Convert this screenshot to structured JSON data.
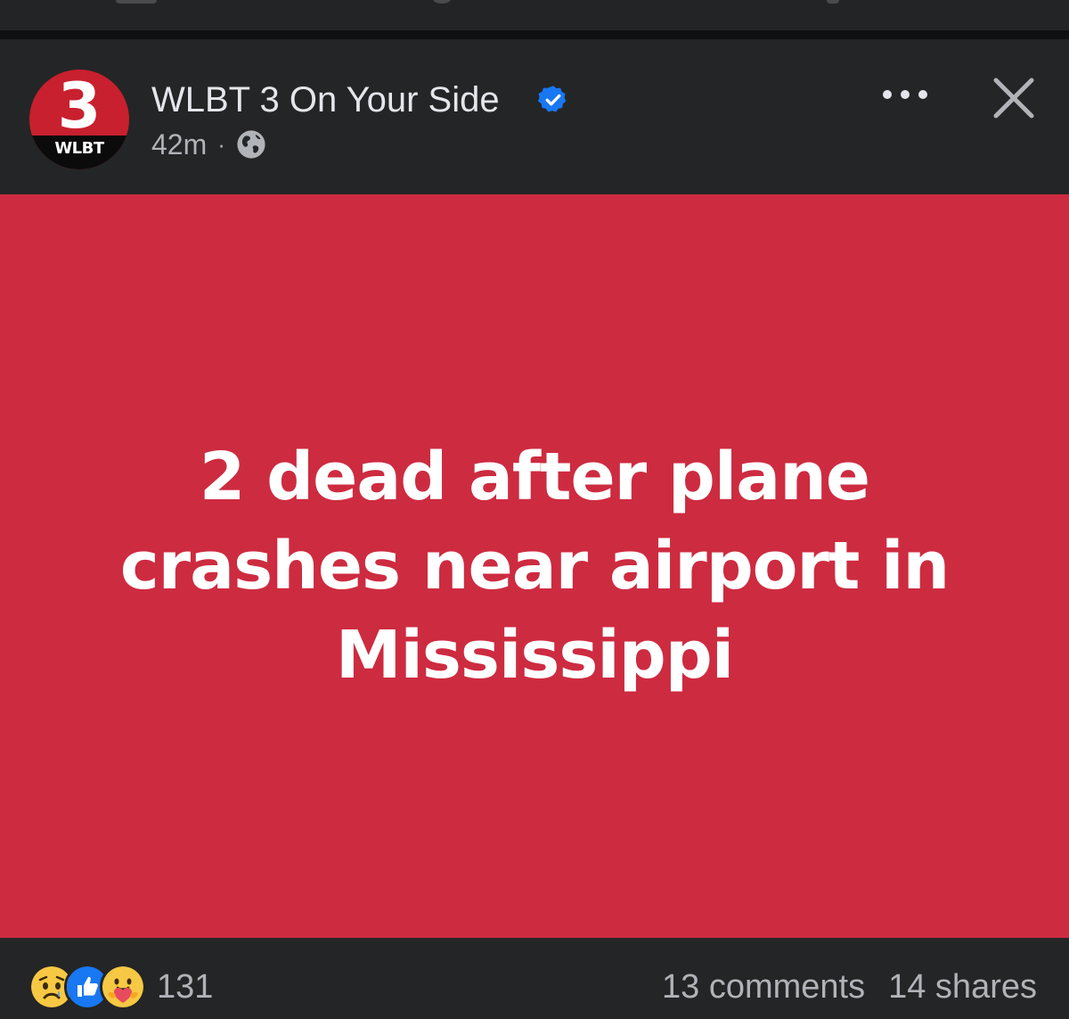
{
  "post": {
    "page_name": "WLBT 3 On Your Side",
    "timestamp": "42m",
    "separator": "·",
    "avatar": {
      "digit": "3",
      "band_text": "WLBT"
    },
    "card": {
      "background_color": "#cd2b40",
      "headline": "2 dead after plane crashes near airport in Mississippi"
    },
    "footer": {
      "reaction_icons": [
        "sad-reaction-icon",
        "like-reaction-icon",
        "care-reaction-icon"
      ],
      "reaction_count": "131",
      "comments": "13 comments",
      "shares": "14 shares"
    }
  },
  "colors": {
    "background": "#242526",
    "text_primary": "#e4e6eb",
    "text_secondary": "#b0b3b8",
    "verified": "#1877f2",
    "brand_red": "#c8202f"
  }
}
